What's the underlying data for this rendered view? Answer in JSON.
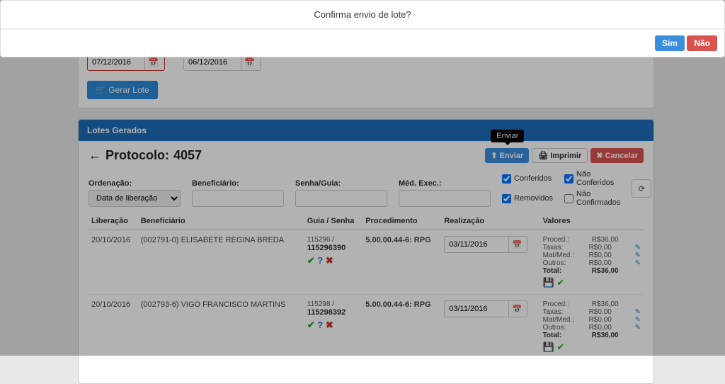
{
  "modal": {
    "title": "Confirma envio de lote?",
    "yes": "Sim",
    "no": "Não"
  },
  "dates": {
    "start": "07/12/2016",
    "end": "06/12/2016"
  },
  "gerar_lote_label": "Gerar Lote",
  "panel_title": "Lotes Gerados",
  "protocol": {
    "label": "Protocolo:",
    "number": "4057"
  },
  "tooltip_enviar": "Enviar",
  "actions": {
    "enviar": "Enviar",
    "imprimir": "Imprimir",
    "cancelar": "Cancelar"
  },
  "filters": {
    "ordenacao_label": "Ordenação:",
    "ordenacao_value": "Data de liberação",
    "beneficiario_label": "Beneficiário:",
    "senha_label": "Senha/Guia:",
    "medexec_label": "Méd. Exec.:"
  },
  "checks": {
    "conferidos": "Conferidos",
    "removidos": "Removidos",
    "nao_conferidos": "Não Conferidos",
    "nao_confirmados": "Não Confirmados"
  },
  "headers": {
    "liberacao": "Liberação",
    "beneficiario": "Beneficiário",
    "guia_senha": "Guia / Senha",
    "procedimento": "Procedimento",
    "realizacao": "Realização",
    "valores": "Valores"
  },
  "value_labels": {
    "proced": "Proced.:",
    "taxas": "Taxas:",
    "matmed": "Mat/Med.:",
    "outros": "Outros:",
    "total": "Total:"
  },
  "rows": [
    {
      "liberacao": "20/10/2016",
      "beneficiario": "(002791-0) ELISABETE REGINA BREDA",
      "guia": "115296 /",
      "senha": "115296390",
      "procedimento": "5.00.00.44-6: RPG",
      "realizacao": "03/11/2016",
      "proced": "R$36,00",
      "taxas": "R$0,00",
      "matmed": "R$0,00",
      "outros": "R$0,00",
      "total": "R$36,00"
    },
    {
      "liberacao": "20/10/2016",
      "beneficiario": "(002793-6) VIGO FRANCISCO MARTINS",
      "guia": "115298 /",
      "senha": "115298392",
      "procedimento": "5.00.00.44-6: RPG",
      "realizacao": "03/11/2016",
      "proced": "R$36,00",
      "taxas": "R$0,00",
      "matmed": "R$0,00",
      "outros": "R$0,00",
      "total": "R$36,00"
    }
  ]
}
